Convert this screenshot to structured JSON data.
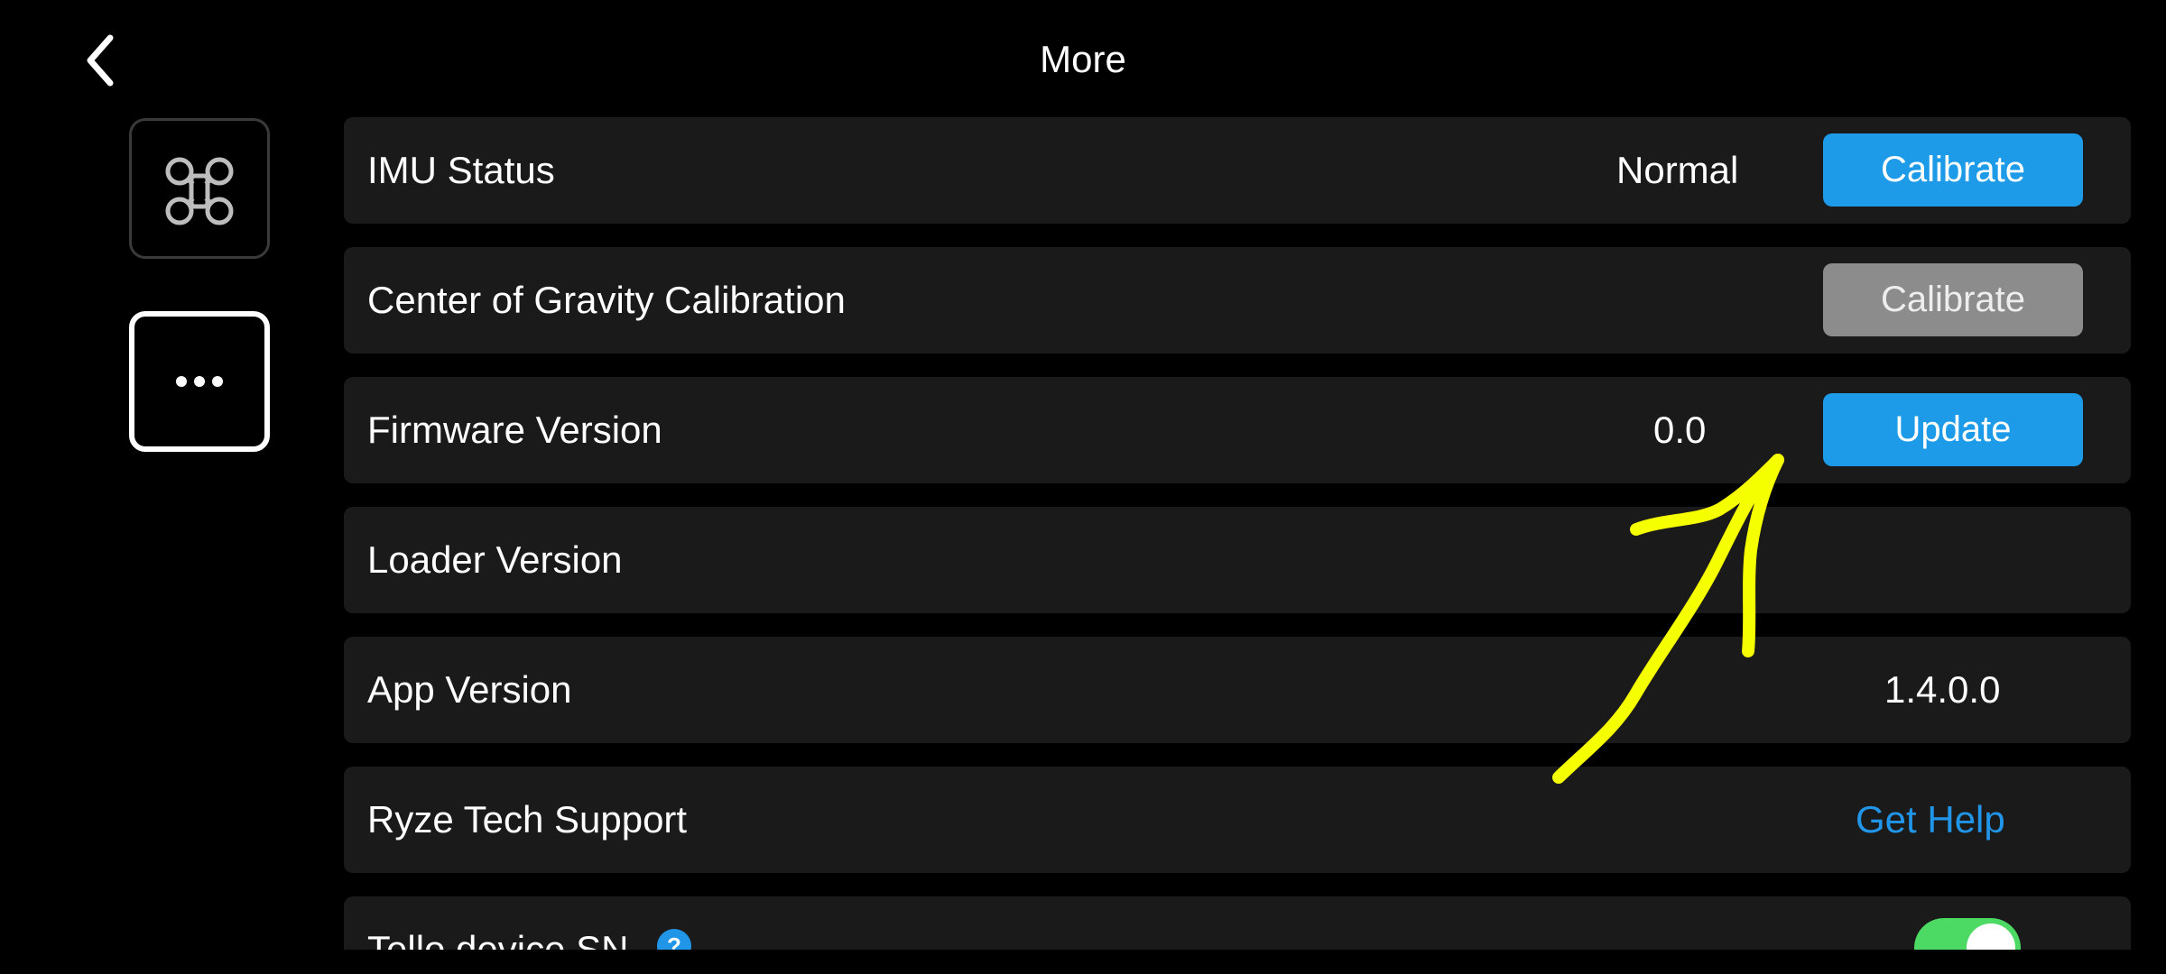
{
  "header": {
    "title": "More",
    "back_icon": "chevron-left-icon"
  },
  "sidebar": {
    "items": [
      {
        "name": "drone",
        "icon": "drone-icon",
        "selected": false
      },
      {
        "name": "more",
        "icon": "ellipsis-icon",
        "selected": true
      }
    ]
  },
  "settings": {
    "imu_status": {
      "label": "IMU Status",
      "value": "Normal",
      "button": "Calibrate"
    },
    "cog_calibration": {
      "label": "Center of Gravity Calibration",
      "button": "Calibrate",
      "button_enabled": false
    },
    "firmware_version": {
      "label": "Firmware Version",
      "value": "0.0",
      "button": "Update"
    },
    "loader_version": {
      "label": "Loader Version",
      "value": ""
    },
    "app_version": {
      "label": "App Version",
      "value": "1.4.0.0"
    },
    "tech_support": {
      "label": "Ryze Tech Support",
      "link": "Get Help"
    },
    "device_sn": {
      "label": "Tello device SN",
      "help_icon": "?",
      "toggle_on": true
    }
  },
  "colors": {
    "background": "#000000",
    "row_background": "#1a1a1a",
    "accent_blue": "#1e9be8",
    "disabled_grey": "#8c8c8c",
    "link_blue": "#2196e8",
    "toggle_green": "#4cd964",
    "annotation_yellow": "#f5ff00"
  }
}
